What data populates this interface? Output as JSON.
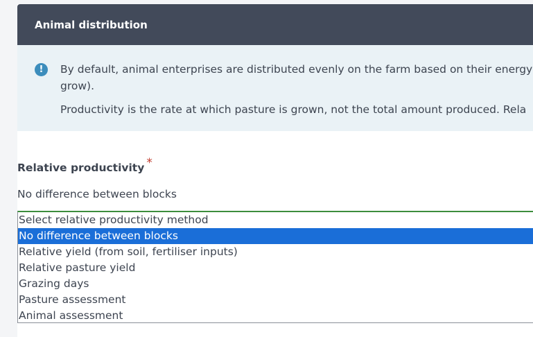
{
  "card": {
    "title": "Animal distribution"
  },
  "info": {
    "icon": "exclamation-info-icon",
    "paragraph1_line1": "By default, animal enterprises are distributed evenly on the farm based on their energy",
    "paragraph1_line2": "grow).",
    "paragraph2": "Productivity is the rate at which pasture is grown, not the total amount produced. Rela"
  },
  "field": {
    "label": "Relative productivity",
    "required_mark": "*",
    "current_value": "No difference between blocks"
  },
  "dropdown": {
    "options": [
      "Select relative productivity method",
      "No difference between blocks",
      "Relative yield (from soil, fertiliser inputs)",
      "Relative pasture yield",
      "Grazing days",
      "Pasture assessment",
      "Animal assessment"
    ],
    "selected_index": 1
  },
  "colors": {
    "header_bg": "#424a5a",
    "info_bg": "#eaf2f6",
    "info_icon": "#3c8dbc",
    "selected_bg": "#1a6ed8",
    "required": "#c0392b"
  }
}
